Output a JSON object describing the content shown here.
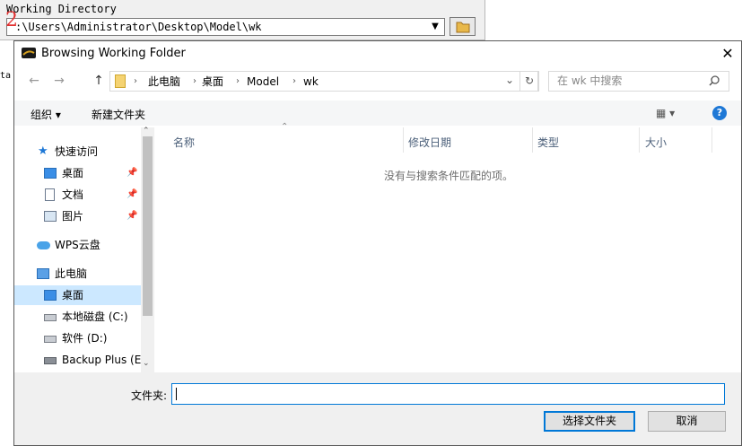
{
  "background_app": {
    "label": "Working Directory",
    "path": ":\\Users\\Administrator\\Desktop\\Model\\wk",
    "marker": "2",
    "side_text": "ta"
  },
  "dialog": {
    "title": "Browsing Working Folder",
    "close": "✕",
    "nav": {
      "back": "←",
      "forward": "→",
      "up": "↑",
      "refresh": "↻",
      "dropdown": "⌄"
    },
    "breadcrumb": [
      "此电脑",
      "桌面",
      "Model",
      "wk"
    ],
    "search_placeholder": "在 wk 中搜索",
    "toolbar": {
      "organize": "组织 ▾",
      "new_folder": "新建文件夹",
      "view": "▦ ▾",
      "help": "?"
    },
    "nav_pane": {
      "quick_access": "快速访问",
      "desktop_pinned": "桌面",
      "documents": "文档",
      "pictures": "图片",
      "wps": "WPS云盘",
      "this_pc": "此电脑",
      "desktop": "桌面",
      "drive_c": "本地磁盘 (C:)",
      "drive_d": "软件 (D:)",
      "backup": "Backup Plus (E"
    },
    "columns": {
      "name": "名称",
      "modified": "修改日期",
      "type": "类型",
      "size": "大小"
    },
    "empty_message": "没有与搜索条件匹配的项。",
    "folder_label": "文件夹:",
    "folder_value": "",
    "buttons": {
      "ok": "选择文件夹",
      "cancel": "取消"
    }
  },
  "colors": {
    "accent": "#0078d7",
    "selected": "#cce8ff",
    "marker": "#e03030"
  }
}
